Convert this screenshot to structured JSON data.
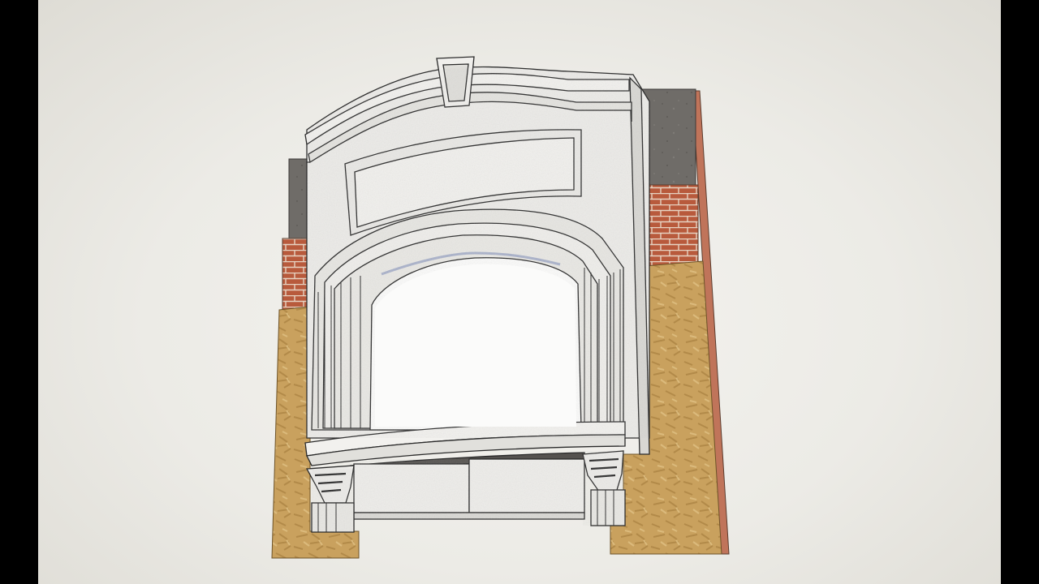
{
  "scene": {
    "subject": "",
    "colors": {
      "background": "#ecebe6",
      "stone": "#ecebe8",
      "stone_shade": "#d8d7d3",
      "line": "#2a2a2a",
      "brick": "#b85a3c",
      "mortar": "#e6d3c2",
      "plywood": "#c9a15e",
      "concrete": "#6f6c68",
      "wood_edge": "#c0745a"
    }
  }
}
